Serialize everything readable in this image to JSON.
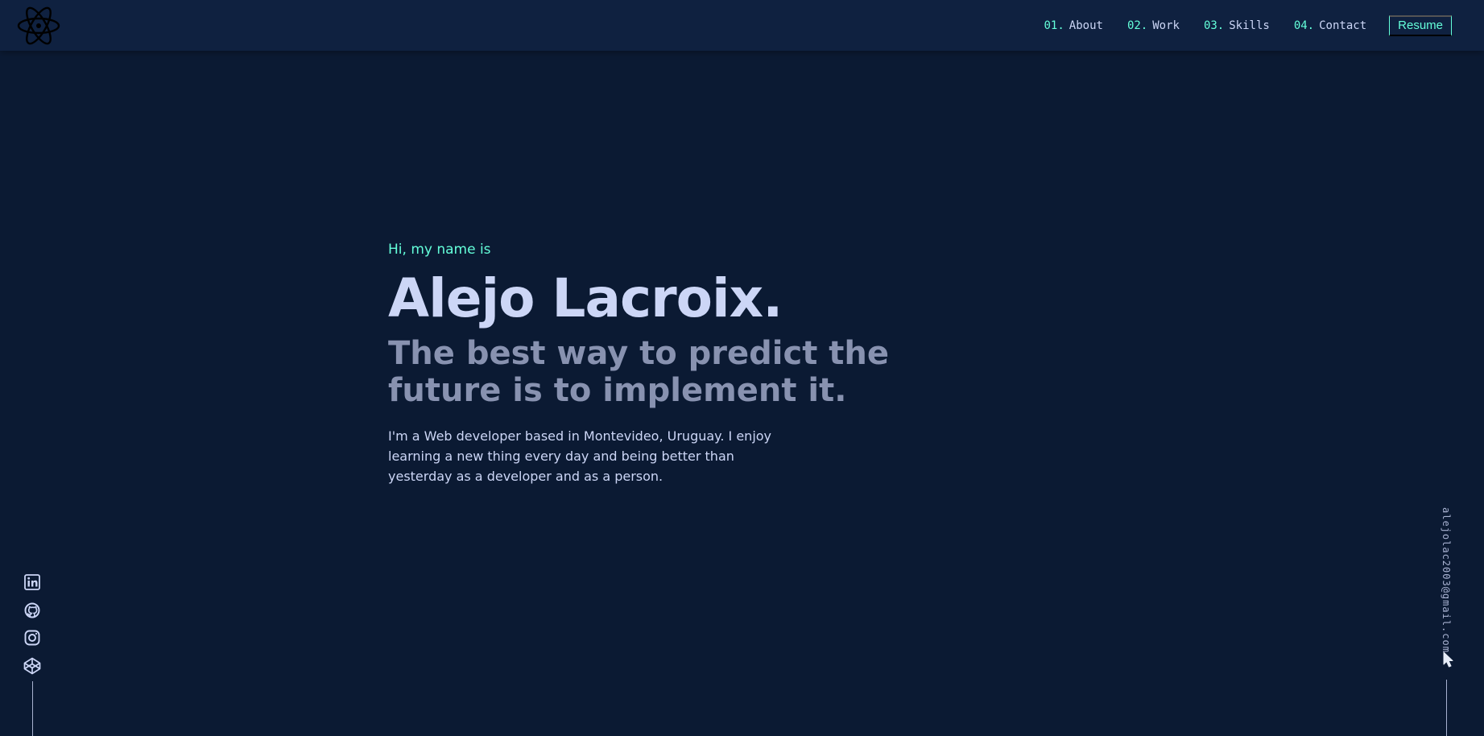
{
  "header": {
    "logo_icon": "atom-logo-icon",
    "nav": [
      {
        "num": "01.",
        "label": "About"
      },
      {
        "num": "02.",
        "label": "Work"
      },
      {
        "num": "03.",
        "label": "Skills"
      },
      {
        "num": "04.",
        "label": "Contact"
      }
    ],
    "resume_label": "Resume"
  },
  "hero": {
    "greeting": "Hi, my name is",
    "name": "Alejo Lacroix.",
    "tagline": "The best way to predict the future is to implement it.",
    "bio": "I'm a Web developer based in Montevideo, Uruguay. I enjoy learning a new thing every day and being better than yesterday as a developer and as a person."
  },
  "social": {
    "icons": [
      "linkedin-icon",
      "github-icon",
      "instagram-icon",
      "codepen-icon"
    ]
  },
  "email": {
    "address": "alejolac2003@gmail.com"
  },
  "colors": {
    "background": "#0b1a33",
    "header": "#0f2140",
    "accent": "#64ffda",
    "heading": "#ccd6f6",
    "muted": "#8892b0"
  }
}
